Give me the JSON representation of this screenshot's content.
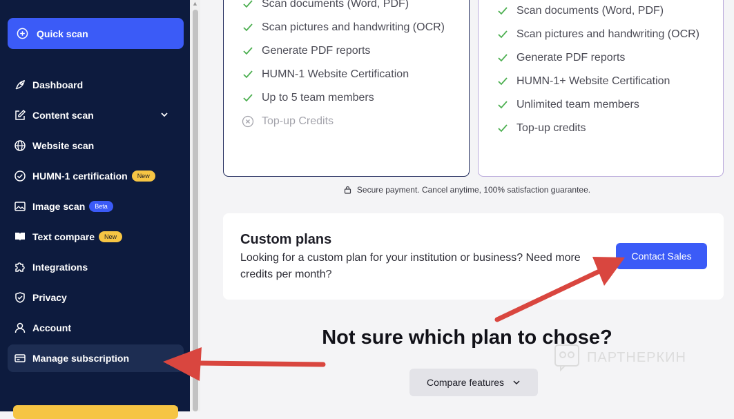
{
  "sidebar": {
    "quick_scan": "Quick scan",
    "items": [
      {
        "label": "Dashboard",
        "icon": "rocket-icon"
      },
      {
        "label": "Content scan",
        "icon": "edit-icon"
      },
      {
        "label": "Website scan",
        "icon": "globe-icon"
      },
      {
        "label": "HUMN-1 certification",
        "icon": "check-circle-icon",
        "badge": "New"
      },
      {
        "label": "Image scan",
        "icon": "image-icon",
        "badge": "Beta"
      },
      {
        "label": "Text compare",
        "icon": "book-icon",
        "badge": "New"
      },
      {
        "label": "Integrations",
        "icon": "puzzle-icon"
      },
      {
        "label": "Privacy",
        "icon": "shield-icon"
      },
      {
        "label": "Account",
        "icon": "user-icon"
      },
      {
        "label": "Manage subscription",
        "icon": "card-icon"
      }
    ]
  },
  "plans": {
    "left": [
      {
        "text": "Scan documents (Word, PDF)",
        "included": true
      },
      {
        "text": "Scan pictures and handwriting (OCR)",
        "included": true
      },
      {
        "text": "Generate PDF reports",
        "included": true
      },
      {
        "text": "HUMN-1 Website Certification",
        "included": true
      },
      {
        "text": "Up to 5 team members",
        "included": true
      },
      {
        "text": "Top-up Credits",
        "included": false
      }
    ],
    "right": [
      {
        "text": "Scan documents (Word, PDF)",
        "included": true
      },
      {
        "text": "Scan pictures and handwriting (OCR)",
        "included": true
      },
      {
        "text": "Generate PDF reports",
        "included": true
      },
      {
        "text": "HUMN-1+ Website Certification",
        "included": true
      },
      {
        "text": "Unlimited team members",
        "included": true
      },
      {
        "text": "Top-up credits",
        "included": true
      }
    ]
  },
  "secure_note": "Secure payment. Cancel anytime, 100% satisfaction guarantee.",
  "custom": {
    "title": "Custom plans",
    "description": "Looking for a custom plan for your institution or business? Need more credits per month?",
    "button": "Contact Sales"
  },
  "compare": {
    "heading": "Not sure which plan to chose?",
    "button": "Compare features"
  },
  "watermark": "ПАРТНЕРКИН",
  "colors": {
    "sidebar_bg": "#0d1b3e",
    "accent": "#3b5bf7",
    "badge_new": "#f6c544",
    "check": "#4caf50",
    "arrow": "#d9463f"
  }
}
